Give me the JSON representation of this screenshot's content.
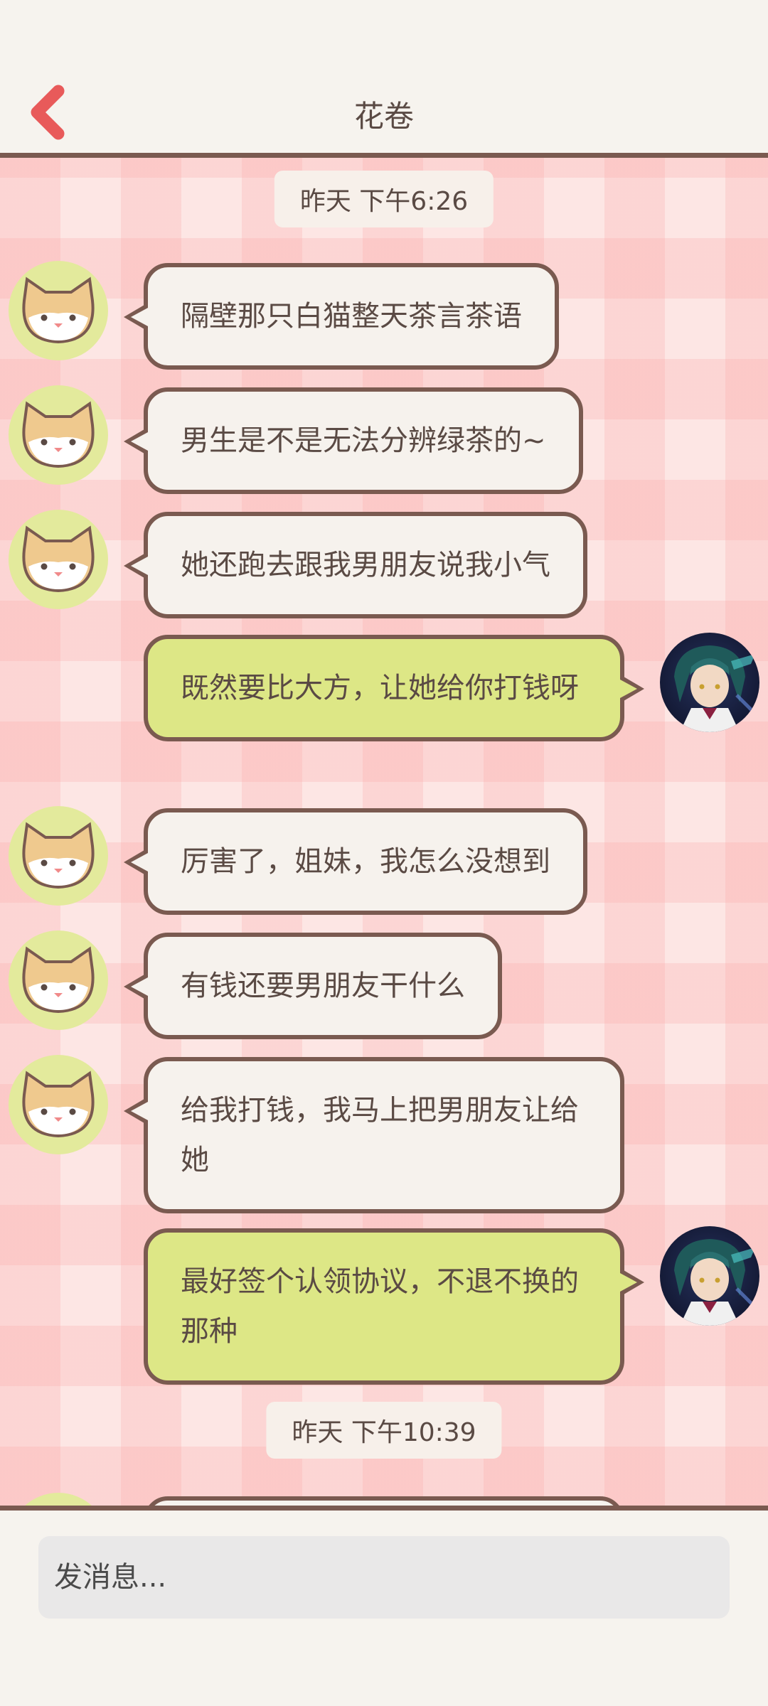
{
  "header": {
    "title": "花卷",
    "back_icon": "chevron-left-icon"
  },
  "messages": [
    {
      "type": "timestamp",
      "text": "昨天 下午6:26"
    },
    {
      "type": "in",
      "text": "隔壁那只白猫整天茶言茶语"
    },
    {
      "type": "in",
      "text": "男生是不是无法分辨绿茶的~"
    },
    {
      "type": "in",
      "text": "她还跑去跟我男朋友说我小气"
    },
    {
      "type": "out",
      "text": "既然要比大方，让她给你打钱呀"
    },
    {
      "type": "in",
      "text": "厉害了，姐妹，我怎么没想到"
    },
    {
      "type": "in",
      "text": "有钱还要男朋友干什么"
    },
    {
      "type": "in",
      "text": "给我打钱，我马上把男朋友让给她"
    },
    {
      "type": "out",
      "text": "最好签个认领协议，不退不换的那种"
    },
    {
      "type": "timestamp",
      "text": "昨天 下午10:39"
    }
  ],
  "input": {
    "placeholder": "发消息..."
  },
  "colors": {
    "incoming_bubble": "#f6f2ed",
    "outgoing_bubble": "#dde786",
    "bubble_border": "#7a5a50",
    "back_arrow": "#e85a5a",
    "cat_avatar_bg": "#e3ea9c"
  }
}
